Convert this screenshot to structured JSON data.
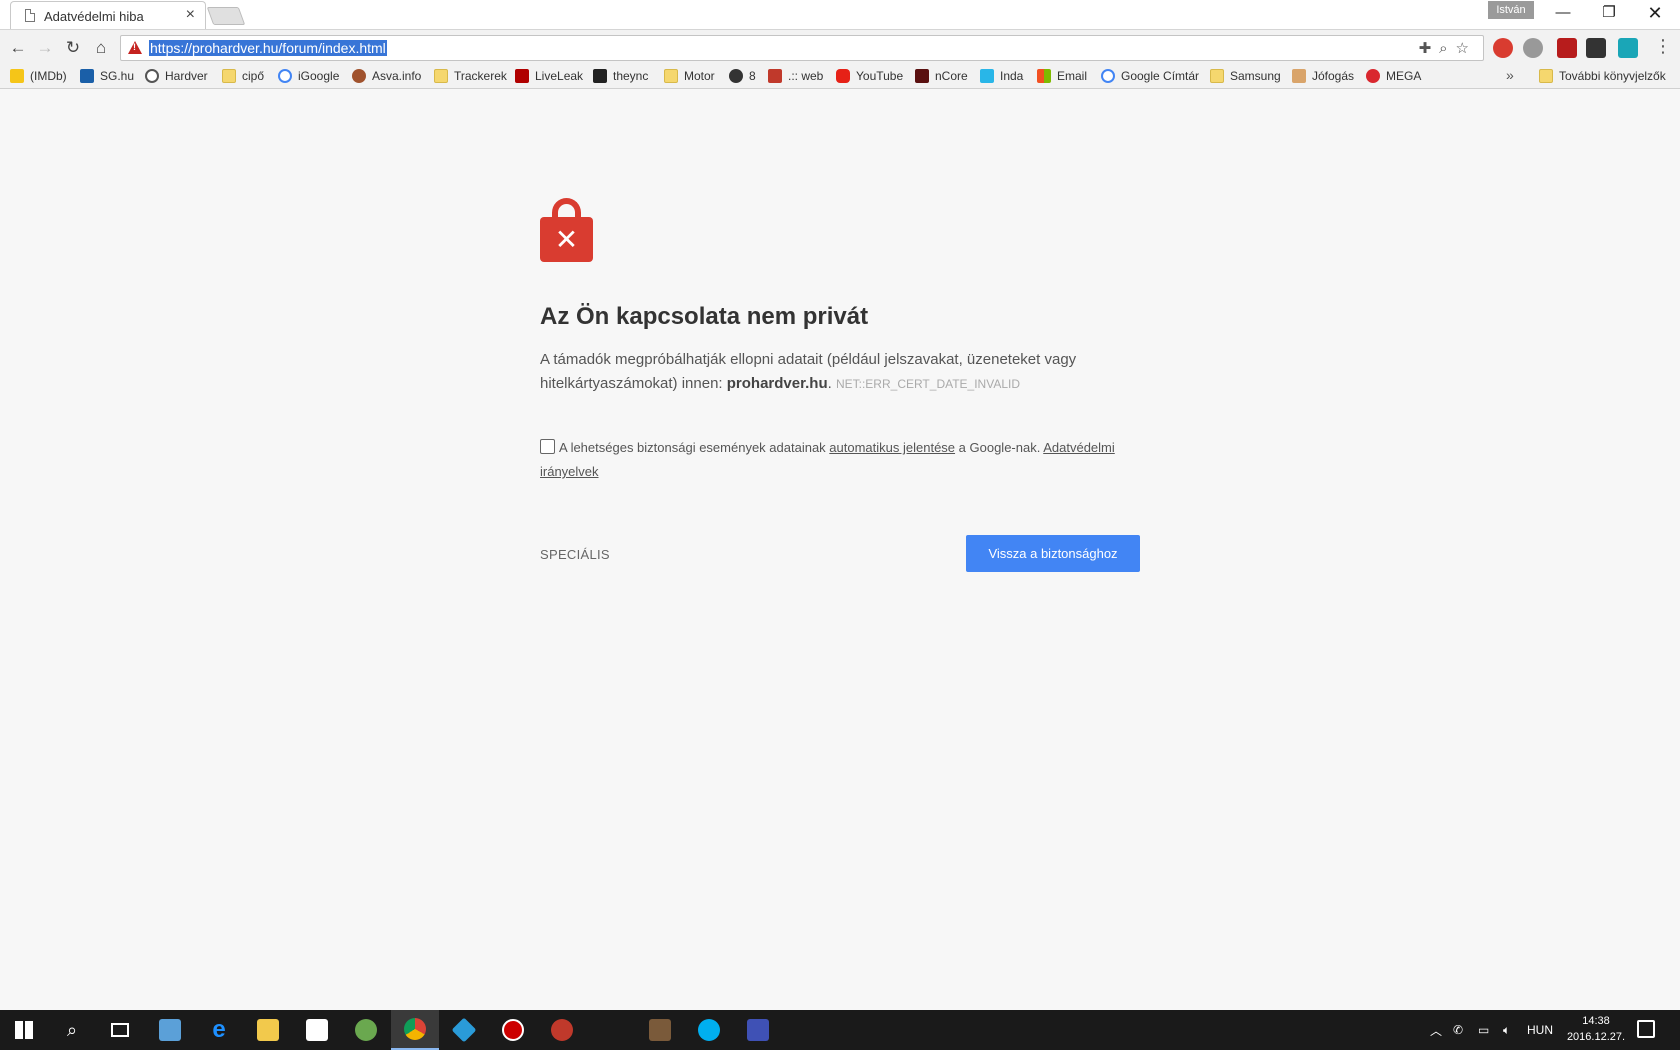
{
  "tab": {
    "title": "Adatvédelmi hiba"
  },
  "window": {
    "profile_name": "István"
  },
  "omnibox": {
    "url": "https://prohardver.hu/forum/index.html"
  },
  "bookmarks": [
    {
      "label": "(IMDb)",
      "icon": "imdb-icon",
      "color": "#f5c518"
    },
    {
      "label": "SG.hu",
      "icon": "sg-icon",
      "color": "#1a5fa8"
    },
    {
      "label": "Hardver",
      "icon": "hardver-icon",
      "color": "#555555"
    },
    {
      "label": "cipő",
      "icon": "folder-icon",
      "color": "#f5d76e"
    },
    {
      "label": "iGoogle",
      "icon": "google-icon",
      "color": "#4285f4"
    },
    {
      "label": "Asva.info",
      "icon": "asva-icon",
      "color": "#a0522d"
    },
    {
      "label": "Trackerek",
      "icon": "folder-icon",
      "color": "#f5d76e"
    },
    {
      "label": "LiveLeak",
      "icon": "liveleak-icon",
      "color": "#b00000"
    },
    {
      "label": "theync",
      "icon": "theync-icon",
      "color": "#222222"
    },
    {
      "label": "Motor",
      "icon": "folder-icon",
      "color": "#f5d76e"
    },
    {
      "label": "8",
      "icon": "camera-icon",
      "color": "#333333"
    },
    {
      "label": ".:: web",
      "icon": "web-icon",
      "color": "#c0392b"
    },
    {
      "label": "YouTube",
      "icon": "youtube-icon",
      "color": "#e62117"
    },
    {
      "label": "nCore",
      "icon": "ncore-icon",
      "color": "#5a1010"
    },
    {
      "label": "Inda",
      "icon": "inda-icon",
      "color": "#29b6e8"
    },
    {
      "label": "Email",
      "icon": "microsoft-icon",
      "color": "#f25022"
    },
    {
      "label": "Google Címtár",
      "icon": "google-icon",
      "color": "#4285f4"
    },
    {
      "label": "Samsung",
      "icon": "folder-icon",
      "color": "#f5d76e"
    },
    {
      "label": "Jófogás",
      "icon": "jofogas-icon",
      "color": "#d9a46a"
    },
    {
      "label": "MEGA",
      "icon": "mega-icon",
      "color": "#d9272e"
    }
  ],
  "bookmarks_overflow": {
    "chevron": "»",
    "other_label": "További könyvjelzők"
  },
  "error": {
    "heading": "Az Ön kapcsolata nem privát",
    "desc_part1": "A támadók megpróbálhatják ellopni adatait (például jelszavakat, üzeneteket vagy hitelkártyaszámokat) innen: ",
    "desc_domain": "prohardver.hu",
    "desc_part2": ". ",
    "error_code": "NET::ERR_CERT_DATE_INVALID",
    "checkbox_text1": "A lehetséges biztonsági események adatainak ",
    "checkbox_link1": "automatikus jelentése",
    "checkbox_text2": " a Google-nak. ",
    "checkbox_link2": "Adatvédelmi irányelvek",
    "advanced_label": "SPECIÁLIS",
    "back_button_label": "Vissza a biztonsághoz",
    "accent_color": "#4285f4",
    "lock_color": "#d93c30"
  },
  "taskbar": {
    "apps": [
      {
        "name": "start-button",
        "color": "#ffffff"
      },
      {
        "name": "search-button",
        "color": "#ffffff"
      },
      {
        "name": "task-view-button",
        "color": "#ffffff"
      },
      {
        "name": "network-app",
        "color": "#5ba0d8"
      },
      {
        "name": "edge-app",
        "color": "#1e90ff"
      },
      {
        "name": "file-explorer-app",
        "color": "#f2c94c"
      },
      {
        "name": "store-app",
        "color": "#ffffff"
      },
      {
        "name": "globe-app",
        "color": "#6aa84f"
      },
      {
        "name": "chrome-app",
        "color": "#db4437"
      },
      {
        "name": "kodi-app",
        "color": "#2a9bd8"
      },
      {
        "name": "recorder-app",
        "color": "#cc0000"
      },
      {
        "name": "game-app",
        "color": "#c0392b"
      },
      {
        "name": "movie-app",
        "color": "#7a5a3a"
      },
      {
        "name": "skype-app",
        "color": "#00aff0"
      },
      {
        "name": "save-app",
        "color": "#3f51b5"
      }
    ],
    "language": "HUN",
    "time": "14:38",
    "date": "2016.12.27."
  }
}
